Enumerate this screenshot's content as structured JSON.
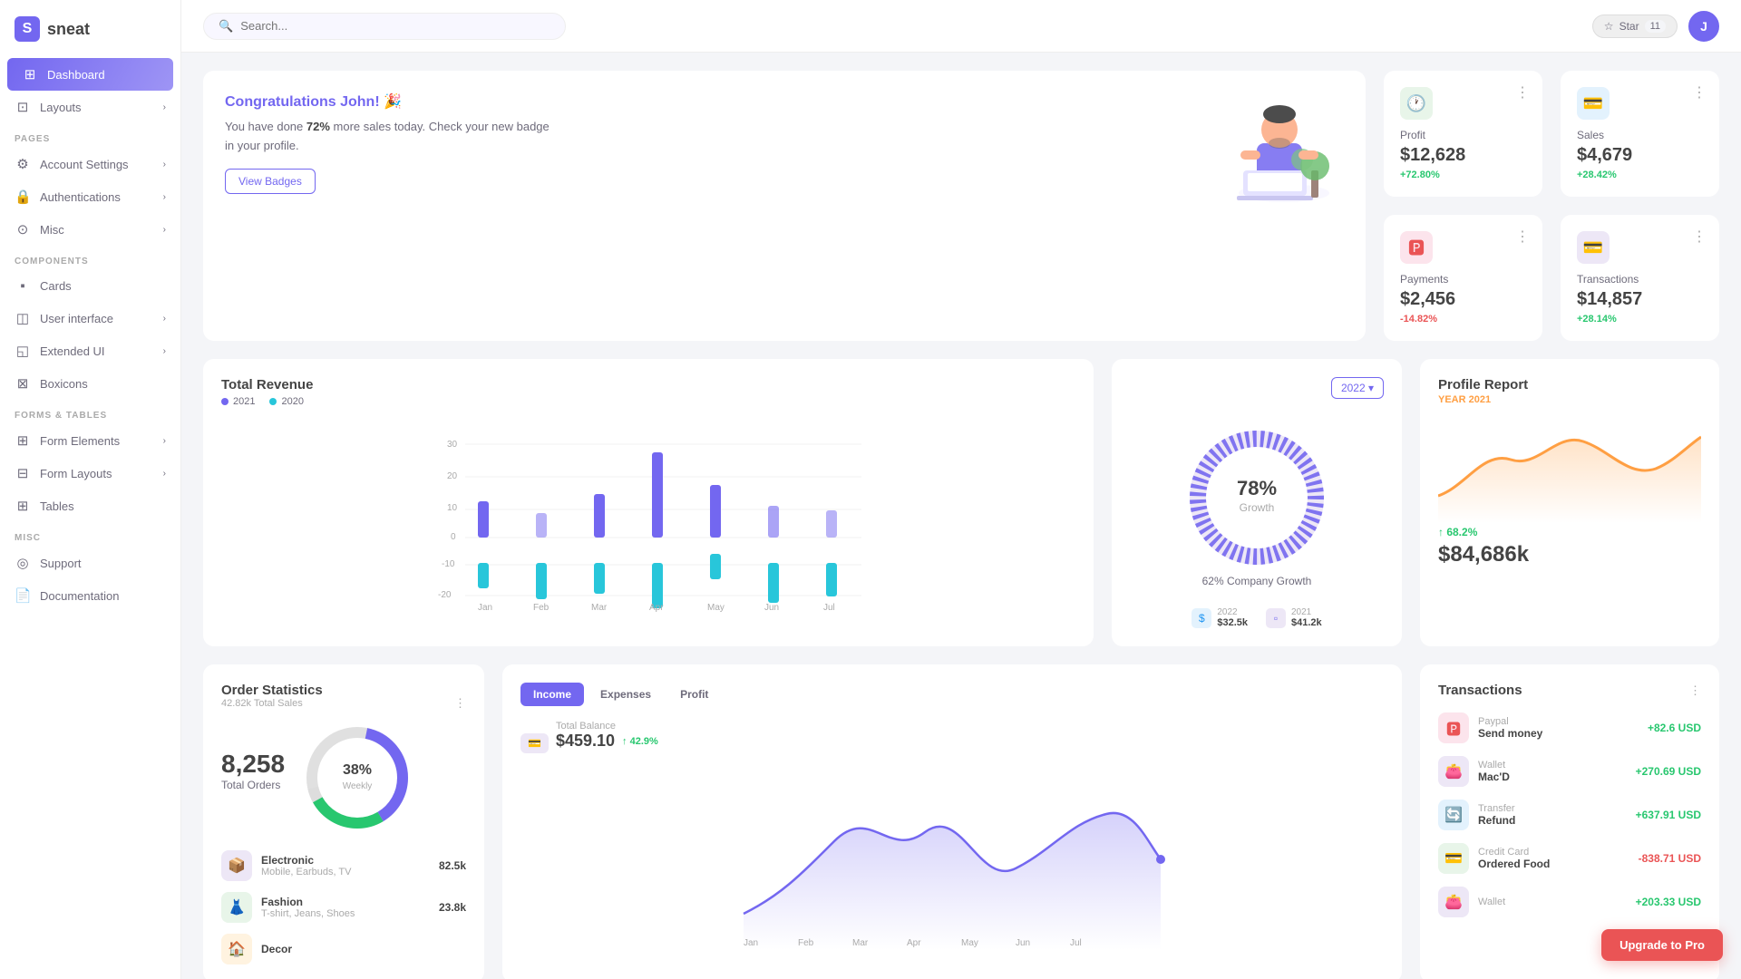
{
  "app": {
    "logo_letter": "S",
    "logo_name": "sneat"
  },
  "sidebar": {
    "sections": [
      {
        "label": "",
        "items": [
          {
            "id": "dashboard",
            "icon": "⊞",
            "label": "Dashboard",
            "active": true,
            "arrow": false
          },
          {
            "id": "layouts",
            "icon": "⊡",
            "label": "Layouts",
            "active": false,
            "arrow": true
          }
        ]
      },
      {
        "label": "PAGES",
        "items": [
          {
            "id": "account-settings",
            "icon": "⚙",
            "label": "Account Settings",
            "active": false,
            "arrow": true
          },
          {
            "id": "authentications",
            "icon": "🔒",
            "label": "Authentications",
            "active": false,
            "arrow": true
          },
          {
            "id": "misc",
            "icon": "⊙",
            "label": "Misc",
            "active": false,
            "arrow": true
          }
        ]
      },
      {
        "label": "COMPONENTS",
        "items": [
          {
            "id": "cards",
            "icon": "▪",
            "label": "Cards",
            "active": false,
            "arrow": false
          },
          {
            "id": "user-interface",
            "icon": "◫",
            "label": "User interface",
            "active": false,
            "arrow": true
          },
          {
            "id": "extended-ui",
            "icon": "◱",
            "label": "Extended UI",
            "active": false,
            "arrow": true
          },
          {
            "id": "boxicons",
            "icon": "⊠",
            "label": "Boxicons",
            "active": false,
            "arrow": false
          }
        ]
      },
      {
        "label": "FORMS & TABLES",
        "items": [
          {
            "id": "form-elements",
            "icon": "⊞",
            "label": "Form Elements",
            "active": false,
            "arrow": true
          },
          {
            "id": "form-layouts",
            "icon": "⊟",
            "label": "Form Layouts",
            "active": false,
            "arrow": true
          },
          {
            "id": "tables",
            "icon": "⊞",
            "label": "Tables",
            "active": false,
            "arrow": false
          }
        ]
      },
      {
        "label": "MISC",
        "items": [
          {
            "id": "support",
            "icon": "◎",
            "label": "Support",
            "active": false,
            "arrow": false
          },
          {
            "id": "documentation",
            "icon": "📄",
            "label": "Documentation",
            "active": false,
            "arrow": false
          }
        ]
      }
    ]
  },
  "topbar": {
    "search_placeholder": "Search...",
    "star_label": "Star",
    "star_count": "11"
  },
  "welcome": {
    "title": "Congratulations John! 🎉",
    "text_prefix": "You have done ",
    "text_highlight": "72%",
    "text_suffix": " more sales today. Check your new badge in your profile.",
    "button_label": "View Badges"
  },
  "stats": [
    {
      "id": "profit",
      "icon": "🕐",
      "icon_bg": "#e8f5e9",
      "label": "Profit",
      "value": "$12,628",
      "change": "+72.80%",
      "change_dir": "up"
    },
    {
      "id": "sales",
      "icon": "💳",
      "icon_bg": "#e3f2fd",
      "label": "Sales",
      "value": "$4,679",
      "change": "+28.42%",
      "change_dir": "up"
    },
    {
      "id": "payments",
      "icon": "🅿",
      "icon_bg": "#fce4ec",
      "label": "Payments",
      "value": "$2,456",
      "change": "-14.82%",
      "change_dir": "down"
    },
    {
      "id": "transactions",
      "icon": "💳",
      "icon_bg": "#ede7f6",
      "label": "Transactions",
      "value": "$14,857",
      "change": "+28.14%",
      "change_dir": "up"
    }
  ],
  "revenue_chart": {
    "title": "Total Revenue",
    "legend": [
      {
        "label": "2021",
        "color": "#7367f0"
      },
      {
        "label": "2020",
        "color": "#28c6da"
      }
    ],
    "months": [
      "Jan",
      "Feb",
      "Mar",
      "Apr",
      "May",
      "Jun",
      "Jul"
    ],
    "data_2021": [
      12,
      8,
      15,
      28,
      18,
      12,
      10
    ],
    "data_2020": [
      -8,
      -12,
      -10,
      -15,
      -8,
      -13,
      -11
    ]
  },
  "growth": {
    "year": "2022",
    "percent": "78%",
    "label": "Growth",
    "company_text": "62% Company Growth",
    "year1_label": "2022",
    "year1_value": "$32.5k",
    "year2_label": "2021",
    "year2_value": "$41.2k"
  },
  "profile_report": {
    "title": "Profile Report",
    "year_label": "YEAR 2021",
    "change": "↑ 68.2%",
    "value": "$84,686k"
  },
  "order_stats": {
    "title": "Order Statistics",
    "subtitle": "42.82k Total Sales",
    "total": "8,258",
    "total_label": "Total Orders",
    "donut_percent": "38%",
    "donut_sublabel": "Weekly",
    "items": [
      {
        "icon": "📦",
        "icon_bg": "#ede7f6",
        "name": "Electronic",
        "sub": "Mobile, Earbuds, TV",
        "value": "82.5k"
      },
      {
        "icon": "👗",
        "icon_bg": "#e8f5e9",
        "name": "Fashion",
        "sub": "T-shirt, Jeans, Shoes",
        "value": "23.8k"
      },
      {
        "icon": "🏠",
        "icon_bg": "#fff3e0",
        "name": "Decor",
        "sub": "",
        "value": ""
      }
    ]
  },
  "income": {
    "tabs": [
      "Income",
      "Expenses",
      "Profit"
    ],
    "active_tab": "Income",
    "balance_label": "Total Balance",
    "balance_value": "$459.10",
    "balance_change": "↑ 42.9%"
  },
  "transactions": {
    "title": "Transactions",
    "items": [
      {
        "icon": "🅿",
        "icon_bg": "#fce4ec",
        "source": "Paypal",
        "name": "Send money",
        "amount": "+82.6 USD",
        "positive": true
      },
      {
        "icon": "👛",
        "icon_bg": "#ede7f6",
        "source": "Wallet",
        "name": "Mac'D",
        "amount": "+270.69 USD",
        "positive": true
      },
      {
        "icon": "🔄",
        "icon_bg": "#e3f2fd",
        "source": "Transfer",
        "name": "Refund",
        "amount": "+637.91 USD",
        "positive": true
      },
      {
        "icon": "💳",
        "icon_bg": "#e8f5e9",
        "source": "Credit Card",
        "name": "Ordered Food",
        "amount": "-838.71 USD",
        "positive": false
      },
      {
        "icon": "👛",
        "icon_bg": "#ede7f6",
        "source": "Wallet",
        "name": "",
        "amount": "+203.33 USD",
        "positive": true
      }
    ]
  },
  "upgrade": {
    "label": "Upgrade to Pro"
  }
}
